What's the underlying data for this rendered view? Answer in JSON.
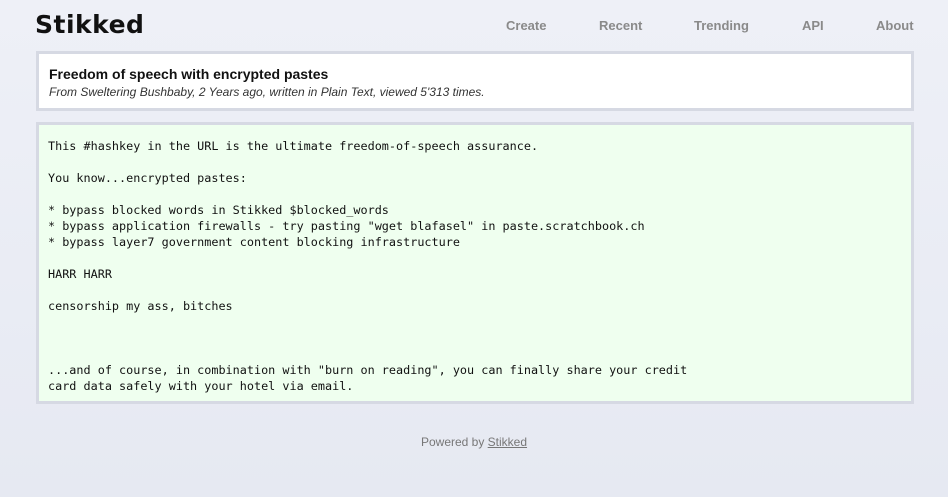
{
  "brand": "Stikked",
  "nav": [
    "Create",
    "Recent",
    "Trending",
    "API",
    "About"
  ],
  "paste": {
    "title": "Freedom of speech with encrypted pastes",
    "meta": "From Sweltering Bushbaby, 2 Years ago, written in Plain Text, viewed 5'313 times.",
    "content": "This #hashkey in the URL is the ultimate freedom-of-speech assurance.\n\nYou know...encrypted pastes:\n\n* bypass blocked words in Stikked $blocked_words\n* bypass application firewalls - try pasting \"wget blafasel\" in paste.scratchbook.ch\n* bypass layer7 government content blocking infrastructure\n\nHARR HARR\n\ncensorship my ass, bitches\n\n\n\n...and of course, in combination with \"burn on reading\", you can finally share your credit\ncard data safely with your hotel via email."
  },
  "footer": {
    "prefix": "Powered by ",
    "link": "Stikked"
  }
}
